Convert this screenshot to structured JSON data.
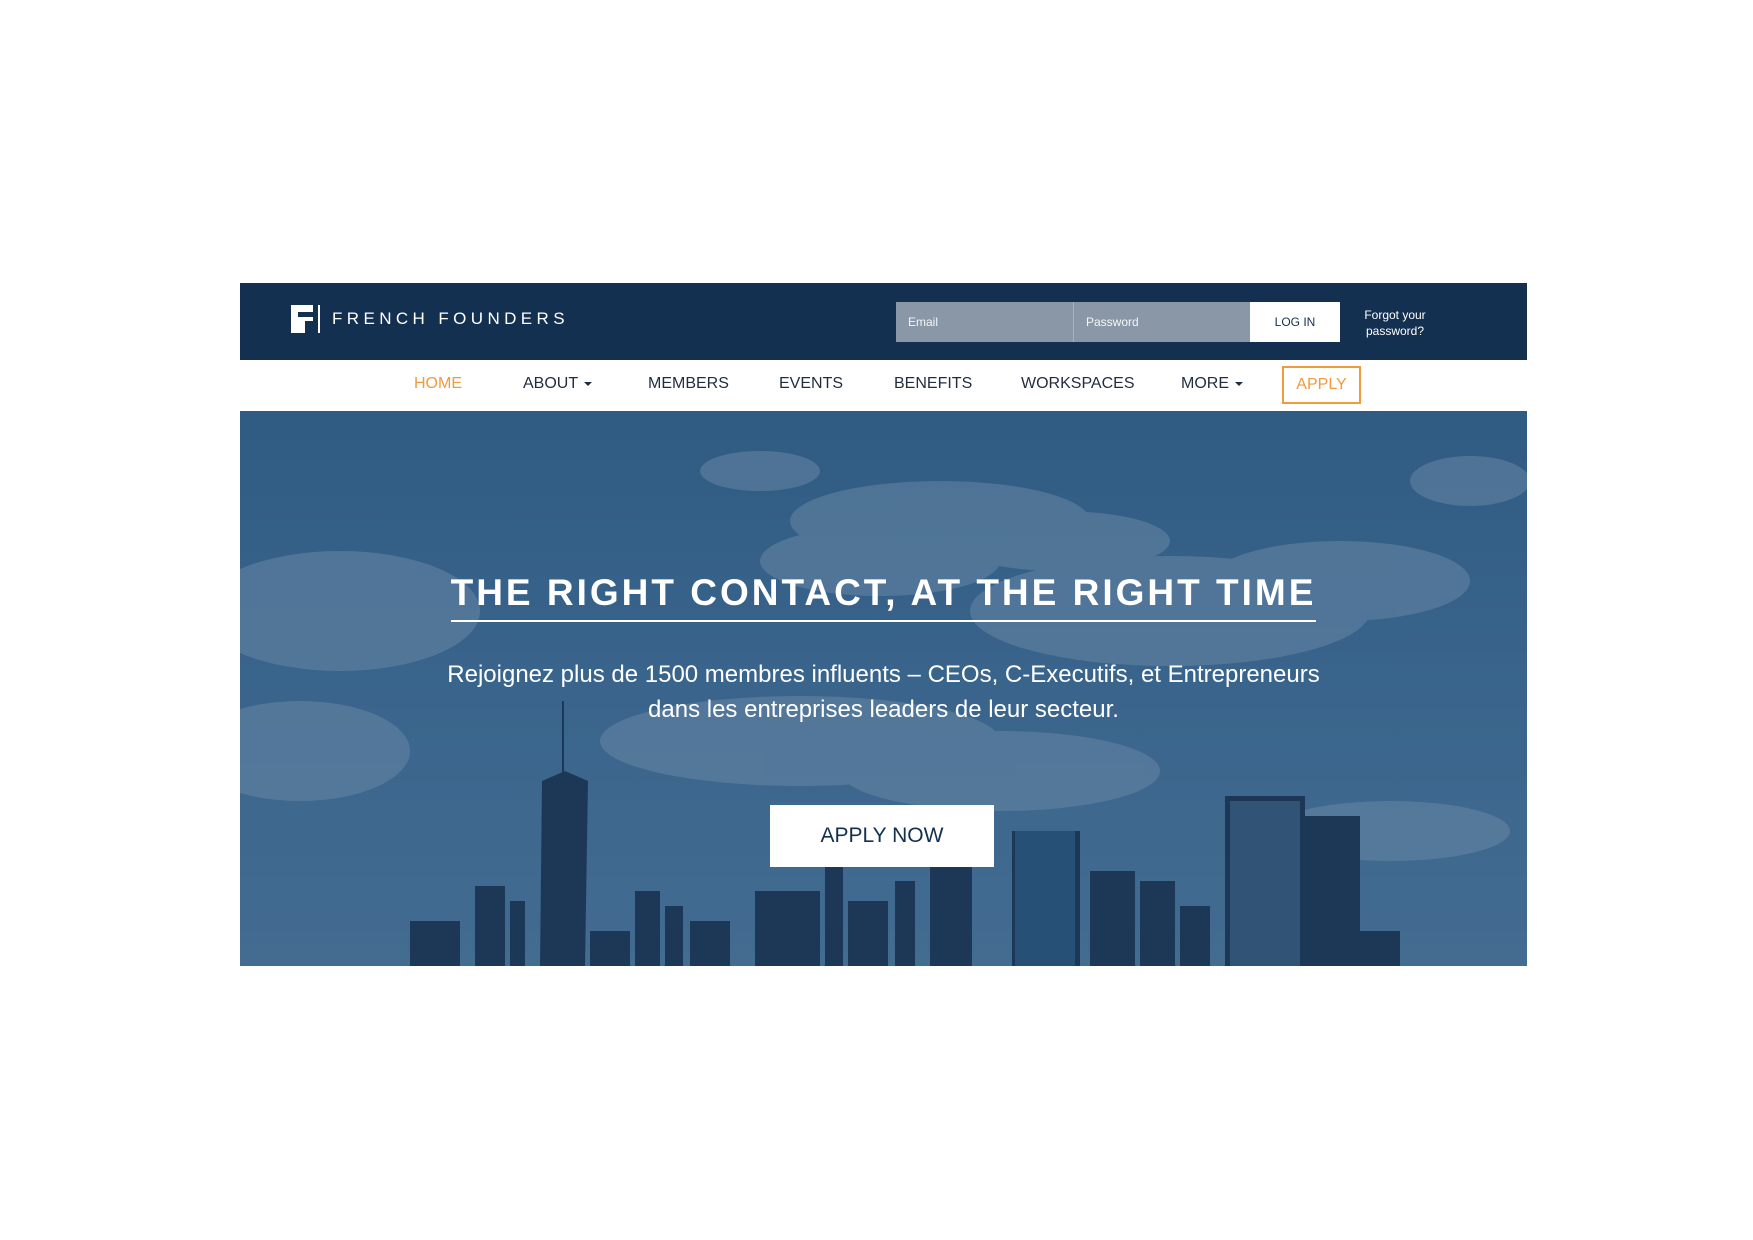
{
  "brand": {
    "logo_letter": "F",
    "name": "FRENCH FOUNDERS",
    "primary_color": "#133050",
    "accent_color": "#f19a3e"
  },
  "login": {
    "email_placeholder": "Email",
    "password_placeholder": "Password",
    "login_label": "LOG IN",
    "forgot_label": "Forgot your password?"
  },
  "nav": {
    "items": [
      {
        "label": "HOME",
        "active": true
      },
      {
        "label": "ABOUT",
        "dropdown": true
      },
      {
        "label": "MEMBERS"
      },
      {
        "label": "EVENTS"
      },
      {
        "label": "BENEFITS"
      },
      {
        "label": "WORKSPACES"
      },
      {
        "label": "MORE",
        "dropdown": true
      }
    ],
    "apply_label": "APPLY"
  },
  "hero": {
    "title": "THE RIGHT CONTACT, AT THE RIGHT TIME",
    "subtitle_line1": "Rejoignez plus de 1500 membres influents – CEOs, C-Executifs, et Entrepreneurs",
    "subtitle_line2": "dans les entreprises leaders de leur secteur.",
    "cta_label": "APPLY NOW"
  }
}
